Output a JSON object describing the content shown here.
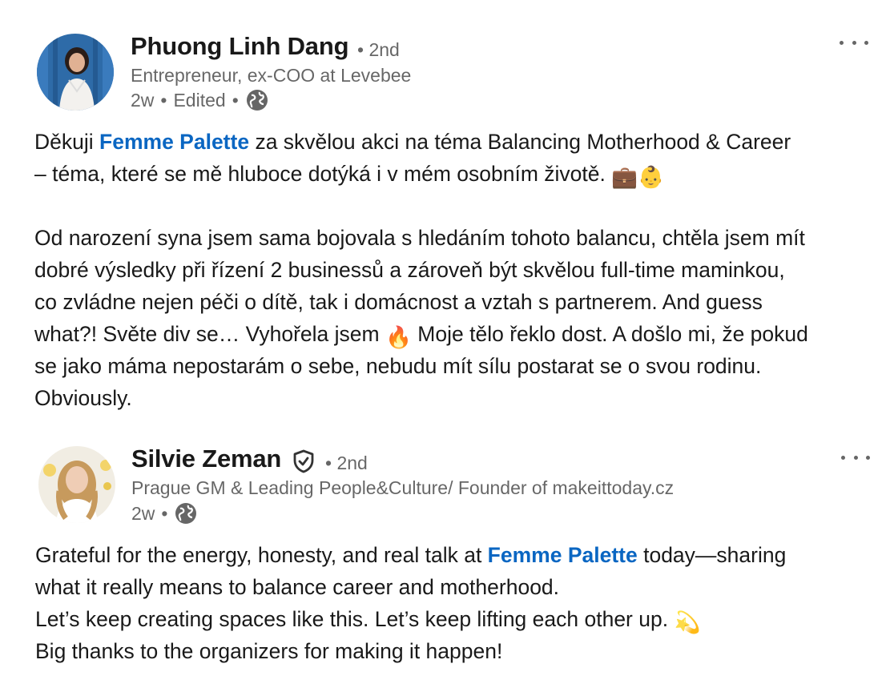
{
  "posts": [
    {
      "author": {
        "name": "Phuong Linh Dang",
        "degree": "• 2nd",
        "headline": "Entrepreneur, ex-COO at Levebee",
        "time": "2w",
        "edited": "Edited",
        "sep": "•",
        "visibility_icon": "globe-icon",
        "avatar_icon": "avatar-woman-blue-wall"
      },
      "more_icon": "more-options-icon",
      "body": {
        "l1_pre": "Děkuji ",
        "l1_mention": "Femme Palette",
        "l1_post": " za skvělou akci na téma Balancing Motherhood & Career",
        "l2": "– téma, které se mě hluboce dotýká i v mém osobním životě. ",
        "l2_emoji": "💼👶",
        "l3": "Od narození syna jsem sama bojovala s hledáním tohoto balancu, chtěla jsem mít",
        "l4": "dobré výsledky při řízení 2 businessů a zároveň být skvělou full-time maminkou,",
        "l5": "co zvládne nejen péči o dítě, tak i domácnost a vztah s partnerem. And guess",
        "l6_pre": "what?! Světe div se… Vyhořela jsem ",
        "l6_emoji": "🔥",
        "l6_post": " Moje tělo řeklo dost. A došlo mi, že pokud",
        "l7": "se jako máma nepostarám o sebe, nebudu mít sílu postarat se o svou rodinu.",
        "l8": "Obviously."
      }
    },
    {
      "author": {
        "name": "Silvie Zeman",
        "verified_icon": "verified-shield-icon",
        "degree": "• 2nd",
        "headline": "Prague GM & Leading People&Culture/ Founder of makeittoday.cz",
        "time": "2w",
        "sep": "•",
        "visibility_icon": "globe-icon",
        "avatar_icon": "avatar-woman-blonde"
      },
      "more_icon": "more-options-icon",
      "body": {
        "l1_pre": "Grateful for the energy, honesty, and real talk at ",
        "l1_mention": "Femme Palette",
        "l1_post": " today—sharing",
        "l2": "what it really means to balance career and motherhood.",
        "l3_pre": "Let’s keep creating spaces like this. Let’s keep lifting each other up. ",
        "l3_emoji": "💫",
        "l4": "Big thanks to the organizers for making it happen!"
      }
    }
  ],
  "colors": {
    "mention": "#0a66c2",
    "primary_text": "rgba(0,0,0,0.9)",
    "secondary_text": "rgba(0,0,0,0.6)"
  }
}
